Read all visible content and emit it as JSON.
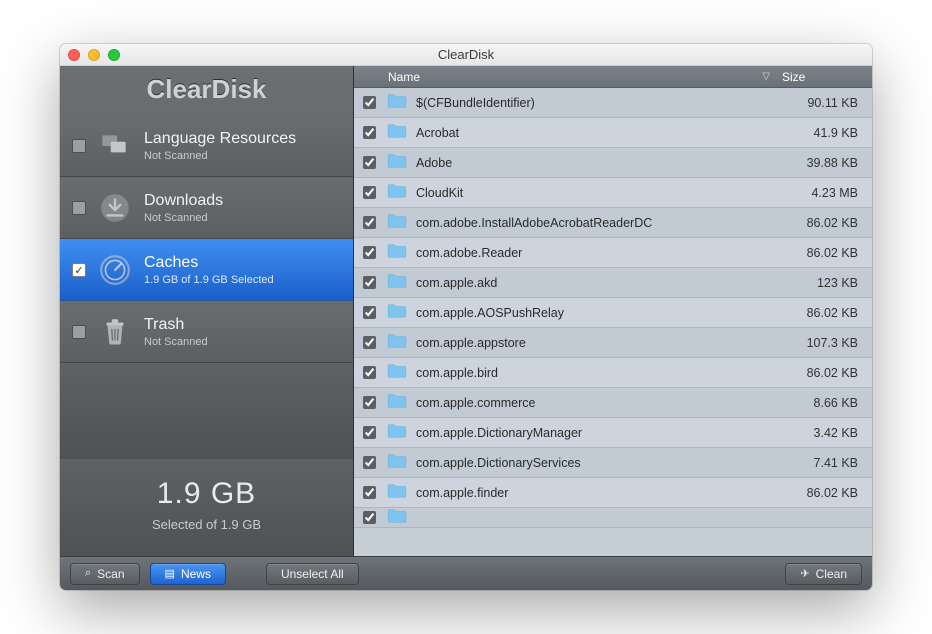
{
  "window": {
    "title": "ClearDisk"
  },
  "brand": "ClearDisk",
  "sidebar": {
    "items": [
      {
        "name": "Language Resources",
        "sub": "Not Scanned",
        "checked": false,
        "active": false,
        "icon": "flags"
      },
      {
        "name": "Downloads",
        "sub": "Not Scanned",
        "checked": false,
        "active": false,
        "icon": "download"
      },
      {
        "name": "Caches",
        "sub": "1.9 GB of 1.9 GB Selected",
        "checked": true,
        "active": true,
        "icon": "gauge"
      },
      {
        "name": "Trash",
        "sub": "Not Scanned",
        "checked": false,
        "active": false,
        "icon": "trash"
      }
    ]
  },
  "summary": {
    "big": "1.9 GB",
    "small": "Selected of 1.9 GB"
  },
  "table": {
    "columns": {
      "name": "Name",
      "size": "Size"
    },
    "rows": [
      {
        "name": "$(CFBundleIdentifier)",
        "size": "90.11 KB",
        "checked": true
      },
      {
        "name": "Acrobat",
        "size": "41.9 KB",
        "checked": true
      },
      {
        "name": "Adobe",
        "size": "39.88 KB",
        "checked": true
      },
      {
        "name": "CloudKit",
        "size": "4.23 MB",
        "checked": true
      },
      {
        "name": "com.adobe.InstallAdobeAcrobatReaderDC",
        "size": "86.02 KB",
        "checked": true
      },
      {
        "name": "com.adobe.Reader",
        "size": "86.02 KB",
        "checked": true
      },
      {
        "name": "com.apple.akd",
        "size": "123 KB",
        "checked": true
      },
      {
        "name": "com.apple.AOSPushRelay",
        "size": "86.02 KB",
        "checked": true
      },
      {
        "name": "com.apple.appstore",
        "size": "107.3 KB",
        "checked": true
      },
      {
        "name": "com.apple.bird",
        "size": "86.02 KB",
        "checked": true
      },
      {
        "name": "com.apple.commerce",
        "size": "8.66 KB",
        "checked": true
      },
      {
        "name": "com.apple.DictionaryManager",
        "size": "3.42 KB",
        "checked": true
      },
      {
        "name": "com.apple.DictionaryServices",
        "size": "7.41 KB",
        "checked": true
      },
      {
        "name": "com.apple.finder",
        "size": "86.02 KB",
        "checked": true
      }
    ]
  },
  "footer": {
    "scan": "Scan",
    "news": "News",
    "unselect": "Unselect All",
    "clean": "Clean"
  }
}
